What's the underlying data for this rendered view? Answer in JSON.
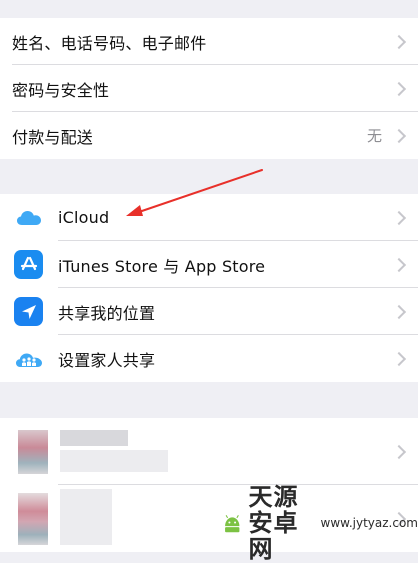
{
  "account_section": {
    "items": [
      {
        "label": "姓名、电话号码、电子邮件",
        "value": ""
      },
      {
        "label": "密码与安全性",
        "value": ""
      },
      {
        "label": "付款与配送",
        "value": "无"
      }
    ]
  },
  "services_section": {
    "items": [
      {
        "label": "iCloud",
        "icon": "icloud-icon",
        "icon_color": "#3fa9f5"
      },
      {
        "label": "iTunes Store 与 App Store",
        "icon": "app-store-icon",
        "icon_color": "#1a8cf0"
      },
      {
        "label": "共享我的位置",
        "icon": "location-arrow-icon",
        "icon_color": "#1a82f0"
      },
      {
        "label": "设置家人共享",
        "icon": "family-sharing-icon",
        "icon_color": "#3fa9f5"
      }
    ]
  },
  "colors": {
    "background": "#efeff4",
    "annotation_arrow": "#e8302a"
  },
  "watermark": {
    "text": "天源安卓网",
    "url": "www.jytyaz.com"
  }
}
